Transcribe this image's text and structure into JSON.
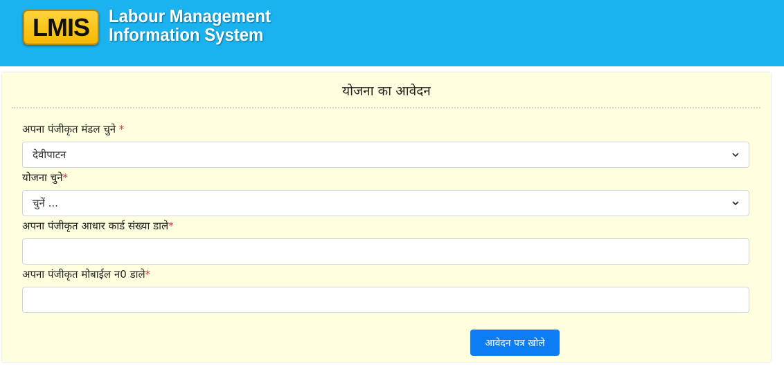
{
  "header": {
    "logo_text": "LMIS",
    "brand_line1": "Labour Management",
    "brand_line2": "Information System"
  },
  "form": {
    "title": "योजना का आवेदन",
    "mandal": {
      "label": "अपना पंजीकृत मंडल चुने ",
      "required": "*",
      "selected": "देवीपाटन"
    },
    "yojana": {
      "label": "योजना चुने",
      "required": "*",
      "selected": "चुनें ..."
    },
    "aadhaar": {
      "label": "अपना पंजीकृत आधार कार्ड संख्या डाले",
      "required": "*",
      "value": ""
    },
    "mobile": {
      "label": "अपना पंजीकृत मोबाईल न0 डाले",
      "required": "*",
      "value": ""
    },
    "submit_label": "आवेदन पत्र खोले"
  },
  "colors": {
    "header_bg": "#1ab3ef",
    "panel_bg": "#fffedf",
    "button_bg": "#0d7df5",
    "required": "#dc3545"
  },
  "icons": {
    "select_arrow": "chevron-down-icon"
  }
}
